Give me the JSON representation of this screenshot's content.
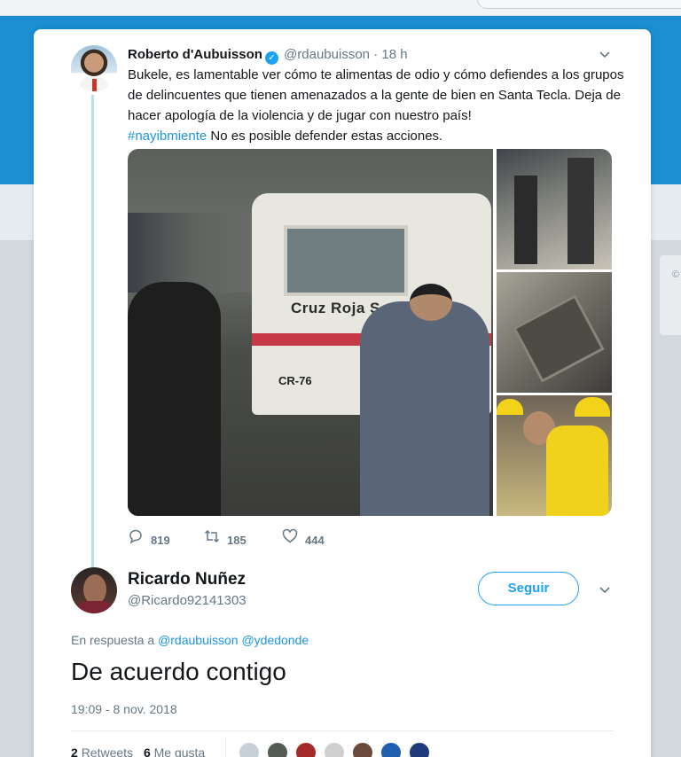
{
  "tweet": {
    "author_name": "Roberto d'Aubuisson",
    "verified_mark": "✓",
    "handle": "@rdaubuisson",
    "separator": "·",
    "time": "18 h",
    "text_main": "Bukele, es lamentable ver cómo te alimentas de odio y cómo defiendes a los grupos de delincuentes que tienen amenazados a la gente de bien en Santa Tecla. Deja de hacer apología de la violencia y de jugar con nuestro país!",
    "hashtag": "#nayibmiente",
    "text_after_hashtag": " No es posible defender estas acciones.",
    "media_text": {
      "van_label": "Cruz Roja S  ado",
      "plate": "CR-76"
    },
    "actions": {
      "replies": "819",
      "retweets": "185",
      "likes": "444"
    }
  },
  "reply": {
    "author_name": "Ricardo Nuñez",
    "handle": "@Ricardo92141303",
    "follow_label": "Seguir",
    "in_reply_prefix": "En respuesta a",
    "mention_1": "@rdaubuisson",
    "mention_2": "@ydedonde",
    "text": "De acuerdo contigo",
    "timestamp": "19:09 - 8 nov. 2018",
    "stats": {
      "retweets_count": "2",
      "retweets_label": "Retweets",
      "likes_count": "6",
      "likes_label": "Me gusta"
    }
  },
  "icons": {
    "reply": "comment-icon",
    "retweet": "retweet-icon",
    "like": "heart-icon",
    "more": "chevron-down-icon"
  },
  "colors": {
    "accent": "#1da1f2",
    "link": "#1b95e0",
    "thread_line": "#b9dff7",
    "header_blue": "#1b8fd1"
  }
}
